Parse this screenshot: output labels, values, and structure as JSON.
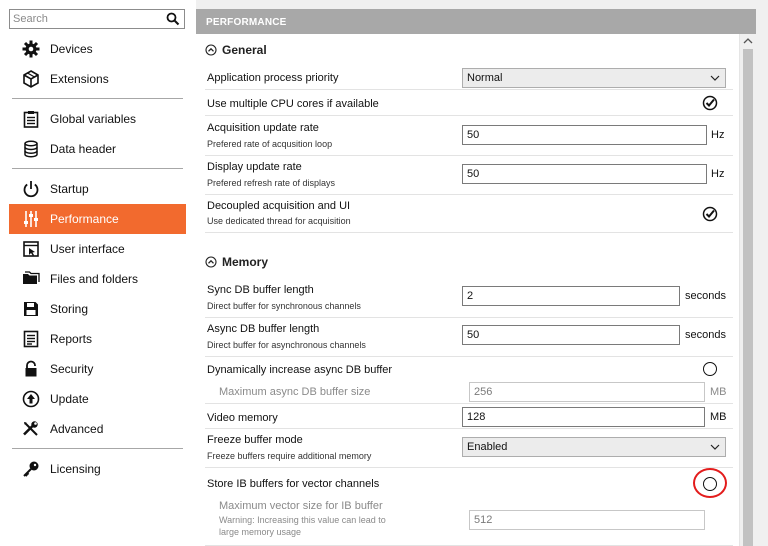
{
  "search": {
    "placeholder": "Search"
  },
  "sidebar": {
    "groups": [
      [
        {
          "label": "Devices",
          "icon": "gear-icon"
        },
        {
          "label": "Extensions",
          "icon": "cube-icon"
        }
      ],
      [
        {
          "label": "Global variables",
          "icon": "clipboard-icon"
        },
        {
          "label": "Data header",
          "icon": "database-icon"
        }
      ],
      [
        {
          "label": "Startup",
          "icon": "power-icon"
        },
        {
          "label": "Performance",
          "icon": "sliders-icon",
          "active": true
        },
        {
          "label": "User interface",
          "icon": "user-interface-icon"
        },
        {
          "label": "Files and folders",
          "icon": "folders-icon"
        },
        {
          "label": "Storing",
          "icon": "floppy-icon"
        },
        {
          "label": "Reports",
          "icon": "report-icon"
        },
        {
          "label": "Security",
          "icon": "lock-icon"
        },
        {
          "label": "Update",
          "icon": "update-icon"
        },
        {
          "label": "Advanced",
          "icon": "tools-icon"
        }
      ],
      [
        {
          "label": "Licensing",
          "icon": "key-icon"
        }
      ]
    ]
  },
  "header": {
    "title": "PERFORMANCE"
  },
  "general": {
    "title": "General",
    "priority": {
      "label": "Application process priority",
      "value": "Normal"
    },
    "multicore": {
      "label": "Use multiple CPU cores if available",
      "checked": true
    },
    "acq_rate": {
      "label": "Acquisition update rate",
      "sub": "Prefered rate of acqusition loop",
      "value": "50",
      "unit": "Hz"
    },
    "disp_rate": {
      "label": "Display update rate",
      "sub": "Prefered refresh rate of displays",
      "value": "50",
      "unit": "Hz"
    },
    "decoupled": {
      "label": "Decoupled acquisition and UI",
      "sub": "Use dedicated thread for acquisition",
      "checked": true
    }
  },
  "memory": {
    "title": "Memory",
    "sync_buf": {
      "label": "Sync DB buffer length",
      "sub": "Direct buffer for synchronous channels",
      "value": "2",
      "unit": "seconds"
    },
    "async_buf": {
      "label": "Async DB buffer length",
      "sub": "Direct buffer for asynchronous channels",
      "value": "50",
      "unit": "seconds"
    },
    "dyn_inc": {
      "label": "Dynamically increase async DB buffer",
      "checked": false
    },
    "max_async": {
      "label": "Maximum async DB buffer size",
      "value": "256",
      "unit": "MB"
    },
    "video": {
      "label": "Video memory",
      "value": "128",
      "unit": "MB"
    },
    "freeze": {
      "label": "Freeze buffer mode",
      "sub": "Freeze buffers require additional memory",
      "value": "Enabled"
    },
    "store_ib": {
      "label": "Store IB buffers for vector channels",
      "checked": false
    },
    "max_vector": {
      "label": "Maximum vector size for IB buffer",
      "sub1": "Warning: Increasing this value can lead to",
      "sub2": "large memory usage",
      "value": "512"
    }
  },
  "colors": {
    "accent": "#f26a2e",
    "header": "#a8a8a8",
    "highlight": "#e31c1c"
  }
}
